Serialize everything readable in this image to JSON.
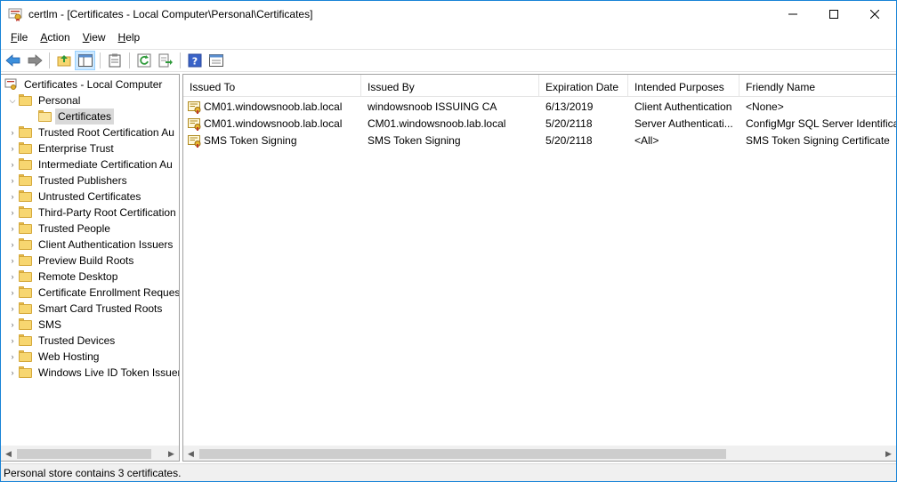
{
  "window": {
    "title": "certlm - [Certificates - Local Computer\\Personal\\Certificates]"
  },
  "menu": [
    {
      "key": "F",
      "rest": "ile"
    },
    {
      "key": "A",
      "rest": "ction"
    },
    {
      "key": "V",
      "rest": "iew"
    },
    {
      "key": "H",
      "rest": "elp"
    }
  ],
  "toolbar": {
    "icons": [
      "back-arrow-icon",
      "forward-arrow-icon",
      "up-folder-icon",
      "show-hide-tree-icon",
      "clipboard-icon",
      "refresh-icon",
      "export-list-icon",
      "help-icon",
      "console-icon"
    ]
  },
  "tree": {
    "root": "Certificates - Local Computer",
    "personal": "Personal",
    "certificates": "Certificates",
    "stores": [
      "Trusted Root Certification Au",
      "Enterprise Trust",
      "Intermediate Certification Au",
      "Trusted Publishers",
      "Untrusted Certificates",
      "Third-Party Root Certification",
      "Trusted People",
      "Client Authentication Issuers",
      "Preview Build Roots",
      "Remote Desktop",
      "Certificate Enrollment Reques",
      "Smart Card Trusted Roots",
      "SMS",
      "Trusted Devices",
      "Web Hosting",
      "Windows Live ID Token Issuer"
    ]
  },
  "list": {
    "columns": [
      "Issued To",
      "Issued By",
      "Expiration Date",
      "Intended Purposes",
      "Friendly Name"
    ],
    "rows": [
      [
        "CM01.windowsnoob.lab.local",
        "windowsnoob ISSUING CA",
        "6/13/2019",
        "Client Authentication",
        "<None>"
      ],
      [
        "CM01.windowsnoob.lab.local",
        "CM01.windowsnoob.lab.local",
        "5/20/2118",
        "Server Authenticati...",
        "ConfigMgr SQL Server Identifica"
      ],
      [
        "SMS Token Signing",
        "SMS Token Signing",
        "5/20/2118",
        "<All>",
        "SMS Token Signing Certificate"
      ]
    ]
  },
  "status": "Personal store contains 3 certificates.",
  "colors": {
    "accent": "#1883d7",
    "folder": "#f7d670",
    "selected": "#d9d9d9",
    "scroll_thumb": "#cdcdcd"
  }
}
